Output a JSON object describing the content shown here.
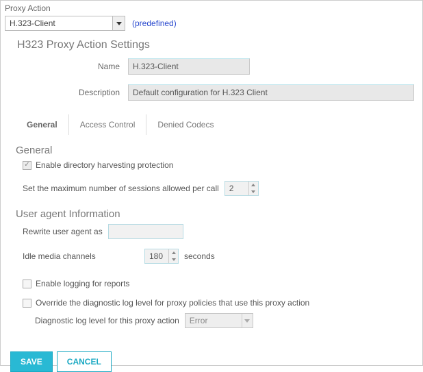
{
  "proxyAction": {
    "label": "Proxy Action",
    "selected": "H.323-Client",
    "predefinedText": "(predefined)"
  },
  "settingsTitle": "H323 Proxy Action Settings",
  "name": {
    "label": "Name",
    "value": "H.323-Client"
  },
  "description": {
    "label": "Description",
    "value": "Default configuration for H.323 Client"
  },
  "tabs": [
    {
      "id": "general",
      "label": "General",
      "active": true
    },
    {
      "id": "access",
      "label": "Access Control",
      "active": false
    },
    {
      "id": "denied",
      "label": "Denied Codecs",
      "active": false
    }
  ],
  "general": {
    "heading": "General",
    "harvestLabel": "Enable directory harvesting protection",
    "harvestChecked": true,
    "harvestDisabled": true,
    "maxSessionsLabel": "Set the maximum number of sessions allowed per call",
    "maxSessionsValue": "2"
  },
  "userAgent": {
    "heading": "User agent Information",
    "rewriteLabel": "Rewrite user agent as",
    "rewriteValue": "",
    "idleLabel": "Idle media channels",
    "idleValue": "180",
    "idleUnit": "seconds"
  },
  "logging": {
    "enableLabel": "Enable logging for reports",
    "enableChecked": false,
    "overrideLabel": "Override the diagnostic log level for proxy policies that use this proxy action",
    "overrideChecked": false,
    "diagLabel": "Diagnostic log level for this proxy action",
    "diagValue": "Error"
  },
  "buttons": {
    "save": "SAVE",
    "cancel": "CANCEL"
  }
}
